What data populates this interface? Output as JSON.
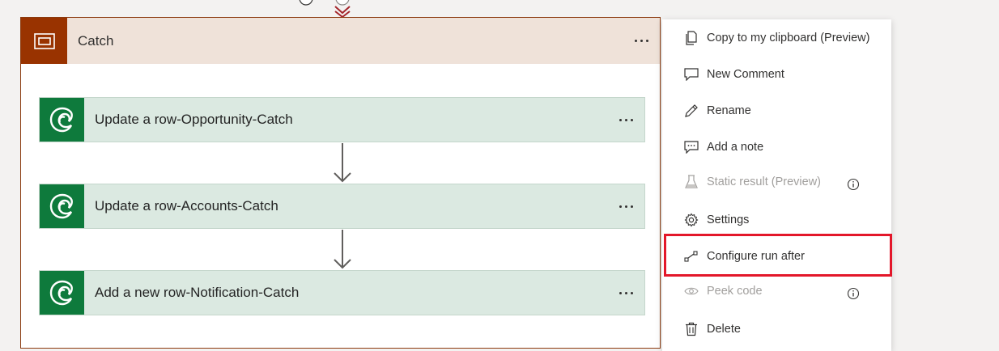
{
  "scope": {
    "title": "Catch",
    "icon": "scope-icon",
    "colors": {
      "border": "#8b3a0f",
      "header_bg": "#efe2d9",
      "icon_bg": "#993300"
    }
  },
  "actions": [
    {
      "title": "Update a row-Opportunity-Catch",
      "icon": "dataverse-icon"
    },
    {
      "title": "Update a row-Accounts-Catch",
      "icon": "dataverse-icon"
    },
    {
      "title": "Add a new row-Notification-Catch",
      "icon": "dataverse-icon"
    }
  ],
  "action_colors": {
    "bg": "#dbe9e1",
    "icon_bg": "#0e7a3c"
  },
  "menu": {
    "items": [
      {
        "label": "Copy to my clipboard (Preview)",
        "icon": "copy-icon",
        "disabled": false
      },
      {
        "label": "New Comment",
        "icon": "comment-icon",
        "disabled": false
      },
      {
        "label": "Rename",
        "icon": "pencil-icon",
        "disabled": false
      },
      {
        "label": "Add a note",
        "icon": "note-icon",
        "disabled": false
      },
      {
        "label": "Static result (Preview)",
        "icon": "flask-icon",
        "disabled": true,
        "info": true
      },
      {
        "label": "Settings",
        "icon": "gear-icon",
        "disabled": false
      },
      {
        "label": "Configure run after",
        "icon": "run-after-icon",
        "disabled": false,
        "highlighted": true
      },
      {
        "label": "Peek code",
        "icon": "eye-icon",
        "disabled": true,
        "info": true
      },
      {
        "label": "Delete",
        "icon": "trash-icon",
        "disabled": false
      }
    ]
  },
  "highlight_color": "#e3172a"
}
